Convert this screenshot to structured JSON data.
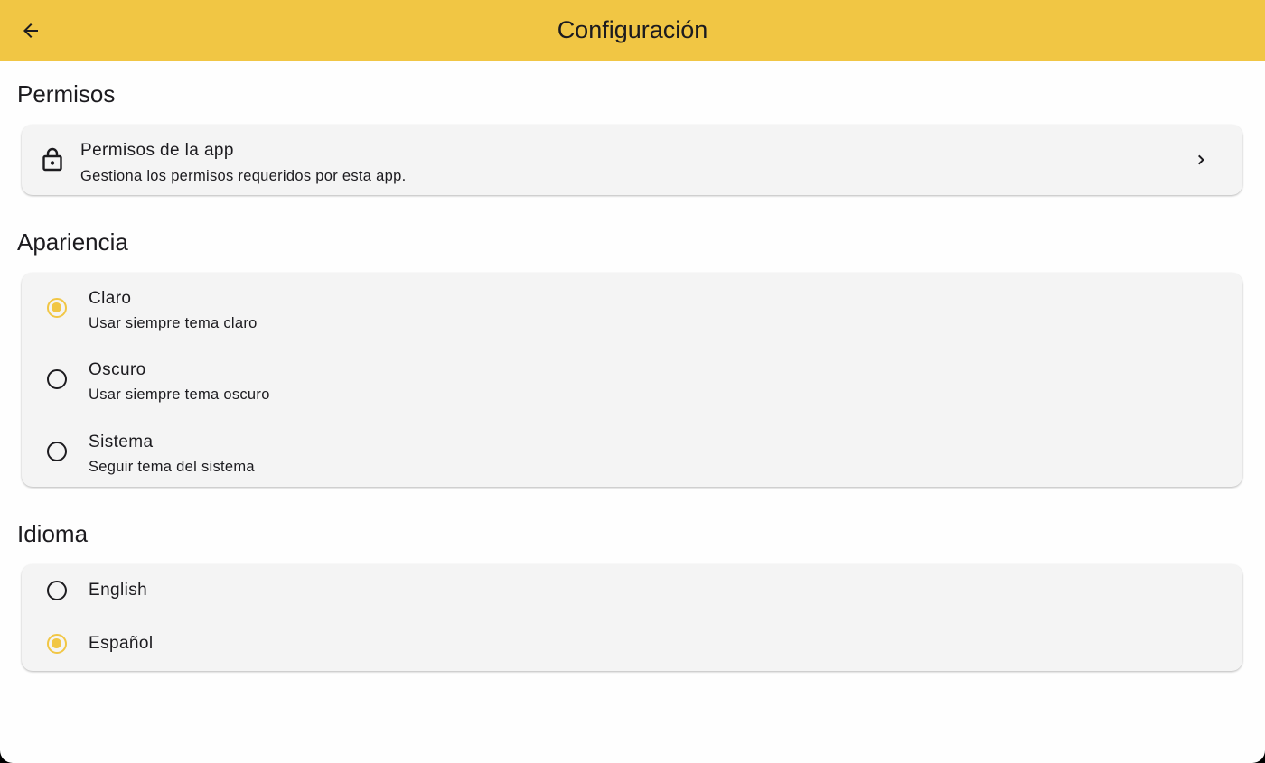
{
  "appbar": {
    "title": "Configuración",
    "back_icon": "arrow-back-icon",
    "background": "#f1c644"
  },
  "permissions": {
    "section_title": "Permisos",
    "item": {
      "icon": "lock-icon",
      "title": "Permisos de la app",
      "subtitle": "Gestiona los permisos requeridos por esta app.",
      "trailing_icon": "chevron-right-icon"
    }
  },
  "appearance": {
    "section_title": "Apariencia",
    "options": [
      {
        "title": "Claro",
        "subtitle": "Usar siempre tema claro",
        "selected": true
      },
      {
        "title": "Oscuro",
        "subtitle": "Usar siempre tema oscuro",
        "selected": false
      },
      {
        "title": "Sistema",
        "subtitle": "Seguir tema del sistema",
        "selected": false
      }
    ]
  },
  "language": {
    "section_title": "Idioma",
    "options": [
      {
        "title": "English",
        "selected": false
      },
      {
        "title": "Español",
        "selected": true
      }
    ]
  },
  "colors": {
    "accent": "#f1c644",
    "card_background": "#f4f4f4",
    "text": "#1c1b1f"
  }
}
